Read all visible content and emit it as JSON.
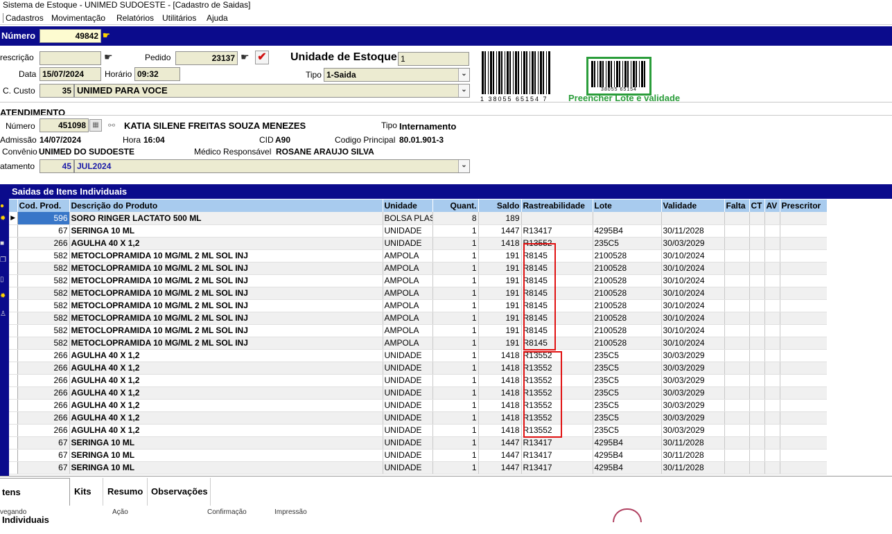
{
  "window": {
    "title": "Sistema de Estoque - UNIMED SUDOESTE - [Cadastro de Saidas]"
  },
  "menu": [
    "Cadastros",
    "Movimentação",
    "Relatórios",
    "Utilitários",
    "Ajuda"
  ],
  "header": {
    "numero_label": "Número",
    "numero_value": "49842",
    "prescricao_label": "rescrição",
    "prescricao_value": "",
    "pedido_label": "Pedido",
    "pedido_value": "23137",
    "unidade_estoque_label": "Unidade de Estoque",
    "unidade_estoque_value": "1",
    "data_label": "Data",
    "data_value": "15/07/2024",
    "horario_label": "Horário",
    "horario_value": "09:32",
    "tipo_label": "Tipo",
    "tipo_value": "1-Saida",
    "custo_label": "C. Custo",
    "custo_code": "35",
    "custo_value": "UNIMED PARA VOCE",
    "barcode_number": "1 38055 65154 7",
    "barcode_small_number": "38055 65154",
    "lote_hint": "Preencher Lote e validade"
  },
  "atendimento": {
    "section_label": "ATENDIMENTO",
    "numero_label": "Número",
    "numero_value": "451098",
    "patient_name": "KATIA SILENE FREITAS SOUZA MENEZES",
    "tipo_label": "Tipo",
    "tipo_value": "Internamento",
    "admissao_label": "Admissão",
    "admissao_value": "14/07/2024",
    "hora_label": "Hora",
    "hora_value": "16:04",
    "cid_label": "CID",
    "cid_value": "A90",
    "codigo_label": "Codigo Principal",
    "codigo_value": "80.01.901-3",
    "convenio_label": "Convênio",
    "convenio_value": "UNIMED DO SUDOESTE",
    "medico_label": "Médico Responsável",
    "medico_value": "ROSANE ARAUJO SILVA",
    "tratamento_label": "atamento",
    "tratamento_code": "45",
    "tratamento_value": "JUL2024"
  },
  "grid": {
    "title": "Saidas de Itens Individuais",
    "columns": [
      "Cod. Prod.",
      "Descrição do Produto",
      "Unidade",
      "Quant.",
      "Saldo",
      "Rastreabilidade",
      "Lote",
      "Validade",
      "Falta",
      "CT",
      "AV",
      "Prescritor"
    ],
    "rows": [
      [
        "596",
        "SORO RINGER LACTATO 500 ML",
        "BOLSA PLAS",
        "8",
        "189",
        "",
        "",
        "",
        "",
        "",
        "",
        ""
      ],
      [
        "67",
        "SERINGA 10 ML",
        "UNIDADE",
        "1",
        "1447",
        "R13417",
        "4295B4",
        "30/11/2028",
        "",
        "",
        "",
        ""
      ],
      [
        "266",
        "AGULHA 40 X 1,2",
        "UNIDADE",
        "1",
        "1418",
        "R13552",
        "235C5",
        "30/03/2029",
        "",
        "",
        "",
        ""
      ],
      [
        "582",
        "METOCLOPRAMIDA 10 MG/ML  2 ML SOL INJ",
        "AMPOLA",
        "1",
        "191",
        "R8145",
        "2100528",
        "30/10/2024",
        "",
        "",
        "",
        ""
      ],
      [
        "582",
        "METOCLOPRAMIDA 10 MG/ML  2 ML SOL INJ",
        "AMPOLA",
        "1",
        "191",
        "R8145",
        "2100528",
        "30/10/2024",
        "",
        "",
        "",
        ""
      ],
      [
        "582",
        "METOCLOPRAMIDA 10 MG/ML  2 ML SOL INJ",
        "AMPOLA",
        "1",
        "191",
        "R8145",
        "2100528",
        "30/10/2024",
        "",
        "",
        "",
        ""
      ],
      [
        "582",
        "METOCLOPRAMIDA 10 MG/ML  2 ML SOL INJ",
        "AMPOLA",
        "1",
        "191",
        "R8145",
        "2100528",
        "30/10/2024",
        "",
        "",
        "",
        ""
      ],
      [
        "582",
        "METOCLOPRAMIDA 10 MG/ML  2 ML SOL INJ",
        "AMPOLA",
        "1",
        "191",
        "R8145",
        "2100528",
        "30/10/2024",
        "",
        "",
        "",
        ""
      ],
      [
        "582",
        "METOCLOPRAMIDA 10 MG/ML  2 ML SOL INJ",
        "AMPOLA",
        "1",
        "191",
        "R8145",
        "2100528",
        "30/10/2024",
        "",
        "",
        "",
        ""
      ],
      [
        "582",
        "METOCLOPRAMIDA 10 MG/ML  2 ML SOL INJ",
        "AMPOLA",
        "1",
        "191",
        "R8145",
        "2100528",
        "30/10/2024",
        "",
        "",
        "",
        ""
      ],
      [
        "582",
        "METOCLOPRAMIDA 10 MG/ML  2 ML SOL INJ",
        "AMPOLA",
        "1",
        "191",
        "R8145",
        "2100528",
        "30/10/2024",
        "",
        "",
        "",
        ""
      ],
      [
        "266",
        "AGULHA 40 X 1,2",
        "UNIDADE",
        "1",
        "1418",
        "R13552",
        "235C5",
        "30/03/2029",
        "",
        "",
        "",
        ""
      ],
      [
        "266",
        "AGULHA 40 X 1,2",
        "UNIDADE",
        "1",
        "1418",
        "R13552",
        "235C5",
        "30/03/2029",
        "",
        "",
        "",
        ""
      ],
      [
        "266",
        "AGULHA 40 X 1,2",
        "UNIDADE",
        "1",
        "1418",
        "R13552",
        "235C5",
        "30/03/2029",
        "",
        "",
        "",
        ""
      ],
      [
        "266",
        "AGULHA 40 X 1,2",
        "UNIDADE",
        "1",
        "1418",
        "R13552",
        "235C5",
        "30/03/2029",
        "",
        "",
        "",
        ""
      ],
      [
        "266",
        "AGULHA 40 X 1,2",
        "UNIDADE",
        "1",
        "1418",
        "R13552",
        "235C5",
        "30/03/2029",
        "",
        "",
        "",
        ""
      ],
      [
        "266",
        "AGULHA 40 X 1,2",
        "UNIDADE",
        "1",
        "1418",
        "R13552",
        "235C5",
        "30/03/2029",
        "",
        "",
        "",
        ""
      ],
      [
        "266",
        "AGULHA 40 X 1,2",
        "UNIDADE",
        "1",
        "1418",
        "R13552",
        "235C5",
        "30/03/2029",
        "",
        "",
        "",
        ""
      ],
      [
        "67",
        "SERINGA 10 ML",
        "UNIDADE",
        "1",
        "1447",
        "R13417",
        "4295B4",
        "30/11/2028",
        "",
        "",
        "",
        ""
      ],
      [
        "67",
        "SERINGA 10 ML",
        "UNIDADE",
        "1",
        "1447",
        "R13417",
        "4295B4",
        "30/11/2028",
        "",
        "",
        "",
        ""
      ],
      [
        "67",
        "SERINGA 10 ML",
        "UNIDADE",
        "1",
        "1447",
        "R13417",
        "4295B4",
        "30/11/2028",
        "",
        "",
        "",
        ""
      ]
    ]
  },
  "tabs": [
    "tens Individuais",
    "Kits",
    "Resumo",
    "Observações"
  ],
  "footer_labels": [
    "vegando",
    "Ação",
    "Confirmação",
    "Impressão"
  ],
  "colors": {
    "blue_bar": "#0b0b8c",
    "field_bg": "#ecebd1",
    "grid_header": "#a8cbee",
    "highlight": "#e01010",
    "green": "#2a9d3a"
  },
  "icons": [
    "pointer-hand-icon",
    "checkmark-icon",
    "calendar-icon",
    "binoculars-icon",
    "row-indicator-icon"
  ]
}
